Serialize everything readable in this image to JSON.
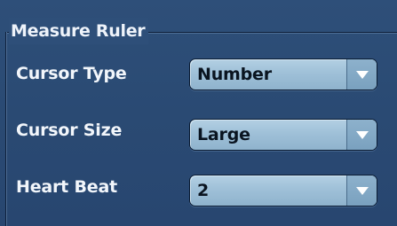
{
  "group": {
    "title": "Measure Ruler"
  },
  "settings": [
    {
      "label": "Cursor Type",
      "value": "Number",
      "icon": "chevron-down-icon"
    },
    {
      "label": "Cursor Size",
      "value": "Large",
      "icon": "chevron-down-icon"
    },
    {
      "label": "Heart Beat",
      "value": "2",
      "icon": "chevron-down-icon"
    }
  ],
  "colors": {
    "panel_background": "#2a4a73",
    "select_background": "#a9c8de",
    "label_text": "#f2f6fb",
    "value_text": "#0a1420"
  }
}
